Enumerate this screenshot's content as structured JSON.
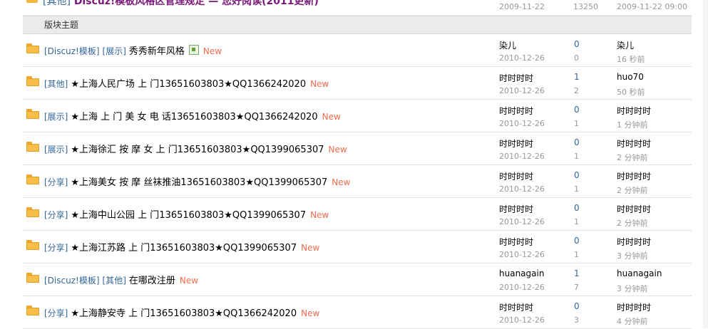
{
  "pinned": {
    "tag": "[其他]",
    "title": "Discuz!模板风格区管理规定 — 您好阅读(2011更新)",
    "date": "2009-11-22",
    "count": "13250",
    "last": "2009-11-22 09:00"
  },
  "section_header": "版块主题",
  "rows": [
    {
      "tags": [
        "[Discuz!模板]",
        "[展示]"
      ],
      "subject": "秀秀新年风格",
      "has_image": true,
      "new": "New",
      "author": "染儿",
      "date": "2010-12-26",
      "replies": "0",
      "views": "0",
      "last_by": "染儿",
      "last_time": "16 秒前"
    },
    {
      "tags": [
        "[其他]"
      ],
      "subject": "★上海人民广场 上 门13651603803★QQ1366242020",
      "has_image": false,
      "new": "New",
      "author": "时时时时",
      "date": "2010-12-26",
      "replies": "1",
      "views": "2",
      "last_by": "huo70",
      "last_time": "50 秒前"
    },
    {
      "tags": [
        "[展示]"
      ],
      "subject": "★上海 上 门 美 女 电 话13651603803★QQ1366242020",
      "has_image": false,
      "new": "New",
      "author": "时时时时",
      "date": "2010-12-26",
      "replies": "0",
      "views": "1",
      "last_by": "时时时时",
      "last_time": "1 分钟前"
    },
    {
      "tags": [
        "[展示]"
      ],
      "subject": "★上海徐汇 按 摩 女 上 门13651603803★QQ1399065307",
      "has_image": false,
      "new": "New",
      "author": "时时时时",
      "date": "2010-12-26",
      "replies": "0",
      "views": "1",
      "last_by": "时时时时",
      "last_time": "2 分钟前"
    },
    {
      "tags": [
        "[分享]"
      ],
      "subject": "★上海美女 按 摩 丝袜推油13651603803★QQ1399065307",
      "has_image": false,
      "new": "New",
      "author": "时时时时",
      "date": "2010-12-26",
      "replies": "0",
      "views": "1",
      "last_by": "时时时时",
      "last_time": "2 分钟前"
    },
    {
      "tags": [
        "[分享]"
      ],
      "subject": "★上海中山公园 上 门13651603803★QQ1399065307",
      "has_image": false,
      "new": "New",
      "author": "时时时时",
      "date": "2010-12-26",
      "replies": "0",
      "views": "1",
      "last_by": "时时时时",
      "last_time": "2 分钟前"
    },
    {
      "tags": [
        "[分享]"
      ],
      "subject": "★上海江苏路 上 门13651603803★QQ1399065307",
      "has_image": false,
      "new": "New",
      "author": "时时时时",
      "date": "2010-12-26",
      "replies": "0",
      "views": "1",
      "last_by": "时时时时",
      "last_time": "3 分钟前"
    },
    {
      "tags": [
        "[Discuz!模板]",
        "[其他]"
      ],
      "subject": "在哪改注册",
      "has_image": false,
      "new": "New",
      "author": "huanagain",
      "date": "2010-12-26",
      "replies": "1",
      "views": "7",
      "last_by": "huanagain",
      "last_time": "3 分钟前"
    },
    {
      "tags": [
        "[分享]"
      ],
      "subject": "★上海静安寺 上 门13651603803★QQ1366242020",
      "has_image": false,
      "new": "New",
      "author": "时时时时",
      "date": "2010-12-26",
      "replies": "0",
      "views": "3",
      "last_by": "时时时时",
      "last_time": "4 分钟前"
    }
  ]
}
